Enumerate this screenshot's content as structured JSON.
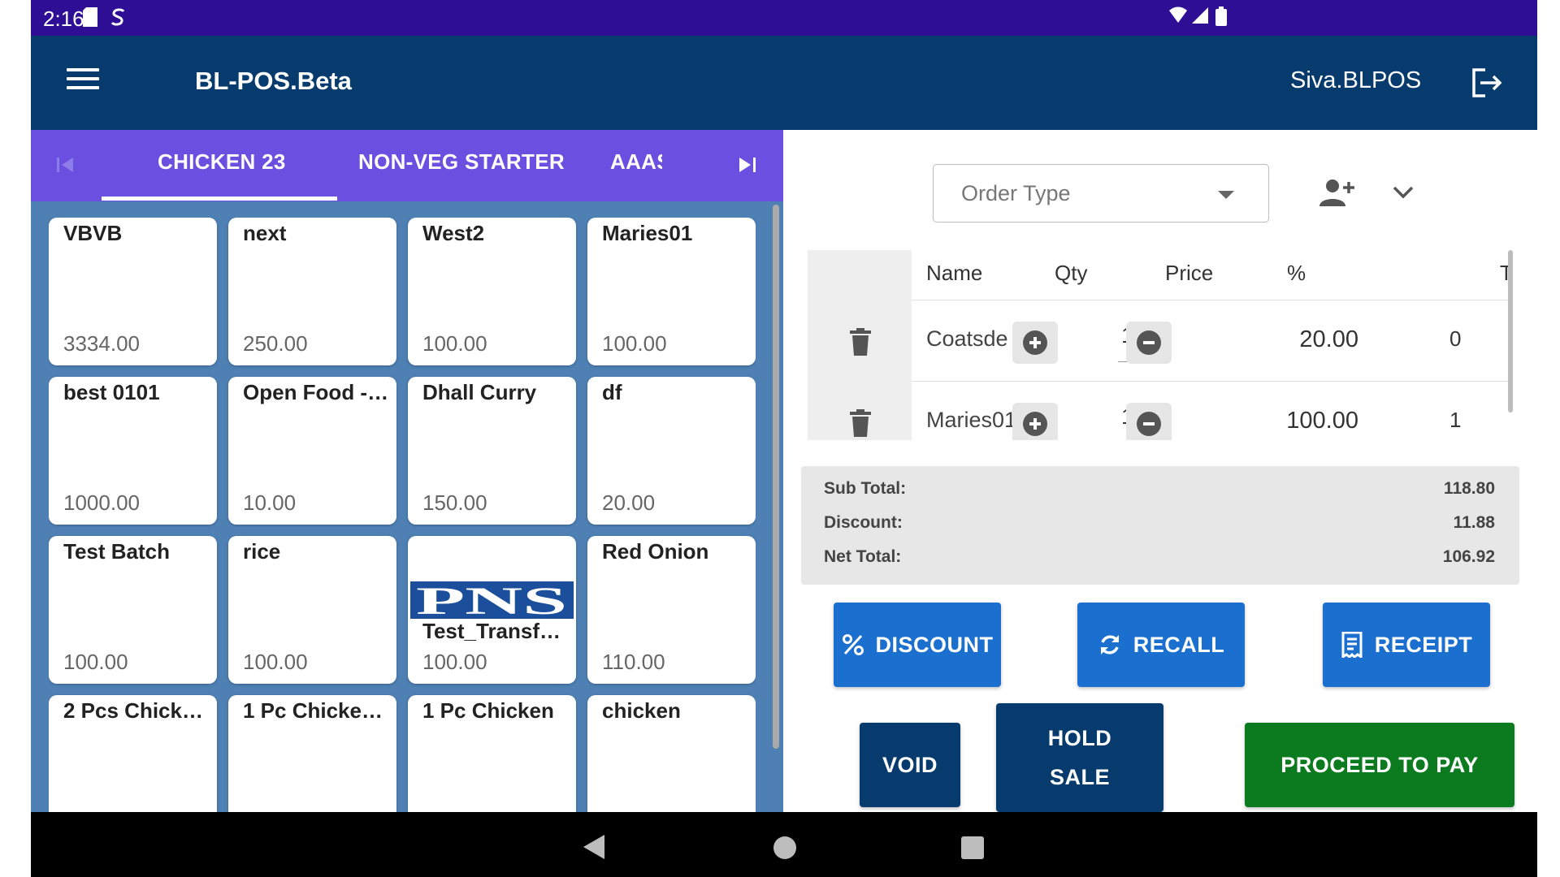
{
  "status_bar": {
    "time": "2:16"
  },
  "app_bar": {
    "title": "BL-POS.Beta",
    "user": "Siva.BLPOS"
  },
  "categories": [
    "CHICKEN 23",
    "NON-VEG STARTER",
    "AAAS"
  ],
  "products": [
    {
      "name": "VBVB",
      "price": "3334.00"
    },
    {
      "name": "next",
      "price": "250.00"
    },
    {
      "name": "West2",
      "price": "100.00"
    },
    {
      "name": "Maries01",
      "price": "100.00"
    },
    {
      "name": "best 0101",
      "price": "1000.00"
    },
    {
      "name": "Open Food - ...",
      "price": "10.00"
    },
    {
      "name": "Dhall Curry",
      "price": "150.00"
    },
    {
      "name": "df",
      "price": "20.00"
    },
    {
      "name": "Test Batch",
      "price": "100.00"
    },
    {
      "name": "rice",
      "price": "100.00"
    },
    {
      "name": "Test_Transfe...",
      "price": "100.00",
      "logo_text": "PNS"
    },
    {
      "name": "Red Onion",
      "price": "110.00"
    },
    {
      "name": "2 Pcs Chicke...",
      "price": ""
    },
    {
      "name": "1 Pc Chicken...",
      "price": ""
    },
    {
      "name": "1 Pc Chicken",
      "price": ""
    },
    {
      "name": "chicken",
      "price": ""
    }
  ],
  "order": {
    "order_type_placeholder": "Order Type",
    "columns": {
      "name": "Name",
      "qty": "Qty",
      "price": "Price",
      "pct": "%",
      "total": "T"
    },
    "items": [
      {
        "name": "Coatsde",
        "qty": "1",
        "price": "20.00",
        "pct": "0"
      },
      {
        "name": "Maries01",
        "qty": "1",
        "price": "100.00",
        "pct": "1"
      }
    ]
  },
  "totals": {
    "sub_total_label": "Sub Total:",
    "sub_total": "118.80",
    "discount_label": "Discount:",
    "discount": "11.88",
    "net_total_label": "Net Total:",
    "net_total": "106.92"
  },
  "actions": {
    "discount": "DISCOUNT",
    "recall": "RECALL",
    "receipt": "RECEIPT",
    "void": "VOID",
    "hold_line1": "HOLD",
    "hold_line2": "SALE",
    "proceed": "PROCEED TO PAY"
  },
  "colors": {
    "status_bar": "#2e0e94",
    "app_bar": "#073b6e",
    "category_tabs": "#6b4fe0",
    "grid_background": "#4e80b4",
    "primary_button": "#1a6fcf",
    "pay_button": "#0c7a1e"
  }
}
